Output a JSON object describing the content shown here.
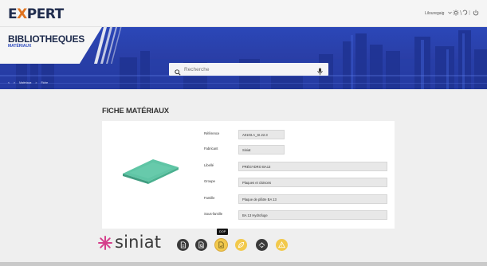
{
  "app": {
    "logo": "EXPERT"
  },
  "topbar": {
    "user_label": "Lilouregaig",
    "icons": [
      "sun-icon",
      "help-icon",
      "power-icon"
    ]
  },
  "banner": {
    "title": "BIBLIOTHEQUES",
    "subtitle": "MATÉRIAUX",
    "search_placeholder": "Recherche",
    "breadcrumb": [
      "Matériaux",
      "Fiche"
    ]
  },
  "content": {
    "heading": "FICHE MATÉRIAUX",
    "fields": [
      {
        "label": "Référence",
        "value": "A0103.A_SI.22.3"
      },
      {
        "label": "Fabricant",
        "value": "Siniat"
      },
      {
        "label": "Libellé",
        "value": "PRÉGYDRO BA13"
      },
      {
        "label": "Groupe",
        "value": "Plaques et cloisons"
      },
      {
        "label": "Famille",
        "value": "Plaque de plâtre BA 13"
      },
      {
        "label": "Sous-famille",
        "value": "BA 13 Hydrofuge"
      }
    ]
  },
  "documents": {
    "brand": "siniat",
    "tooltip": "DOP",
    "buttons": [
      {
        "icon": "doc-icon",
        "color": "#3a3a3a"
      },
      {
        "icon": "doc-search-icon",
        "color": "#3a3a3a"
      },
      {
        "icon": "dop-icon",
        "color": "#f2c94c"
      },
      {
        "icon": "leaf-icon",
        "color": "#f2c94c"
      },
      {
        "icon": "certificate-icon",
        "color": "#3a3a3a"
      },
      {
        "icon": "warning-icon",
        "color": "#f2c94c"
      }
    ]
  },
  "colors": {
    "brand_navy": "#1f2c4d",
    "brand_orange": "#e0731f",
    "banner_blue": "#2a3fa8",
    "accent_yellow": "#f2c94c"
  }
}
